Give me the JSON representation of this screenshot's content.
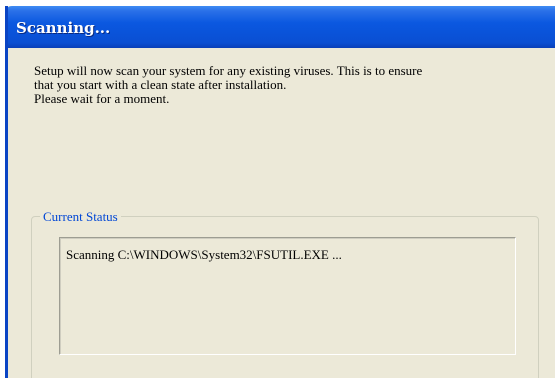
{
  "window": {
    "title": "Scanning..."
  },
  "message": {
    "line1": "Setup will now scan your system for any existing viruses. This is to ensure",
    "line2": "that you start with a clean state after installation.",
    "line3": "Please wait for a moment."
  },
  "status_group": {
    "legend": "Current Status",
    "status_text": "Scanning C:\\WINDOWS\\System32\\FSUTIL.EXE ..."
  },
  "colors": {
    "titlebar": "#0b58e0",
    "window_bg": "#ece9d8",
    "legend_text": "#0046d5"
  }
}
